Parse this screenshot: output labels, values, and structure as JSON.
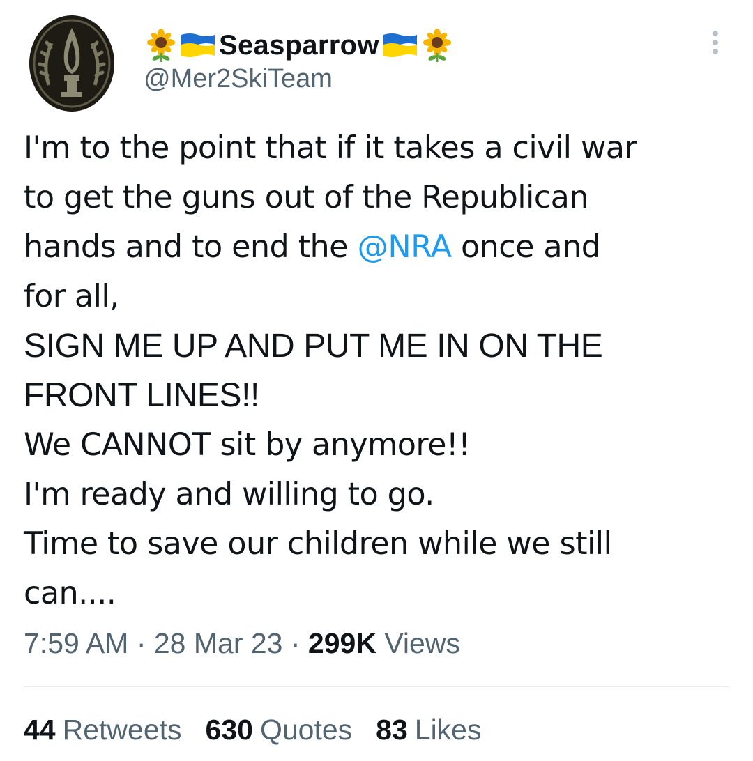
{
  "author": {
    "display_name": "Seasparrow",
    "handle": "@Mer2SkiTeam",
    "avatar_icon": "military-insignia-avatar",
    "name_emoji": [
      "sunflower-icon",
      "ukraine-flag-icon"
    ]
  },
  "tweet": {
    "line1": "I'm to the point that if it takes a civil war",
    "line2": "to get the guns out of the Republican",
    "line3_before": "hands and to end the ",
    "mention": "@NRA",
    "line3_after": " once and",
    "line4": "for all,",
    "line5": "SIGN ME UP AND PUT ME IN ON THE",
    "line6": "FRONT LINES!!",
    "line7": "We CANNOT sit by anymore!!",
    "line8": "I'm ready and willing to go.",
    "line9": "Time to save our children while we still",
    "line10": "can...."
  },
  "meta": {
    "time": "7:59 AM",
    "sep1": " · ",
    "date": "28 Mar 23",
    "sep2": " · ",
    "views_count": "299K",
    "views_label": " Views"
  },
  "stats": {
    "retweets_count": "44",
    "retweets_label": "Retweets",
    "quotes_count": "630",
    "quotes_label": "Quotes",
    "likes_count": "83",
    "likes_label": "Likes"
  },
  "colors": {
    "text": "#0f1419",
    "secondary": "#536471",
    "link": "#1d9bf0",
    "divider": "#e7ebee"
  }
}
